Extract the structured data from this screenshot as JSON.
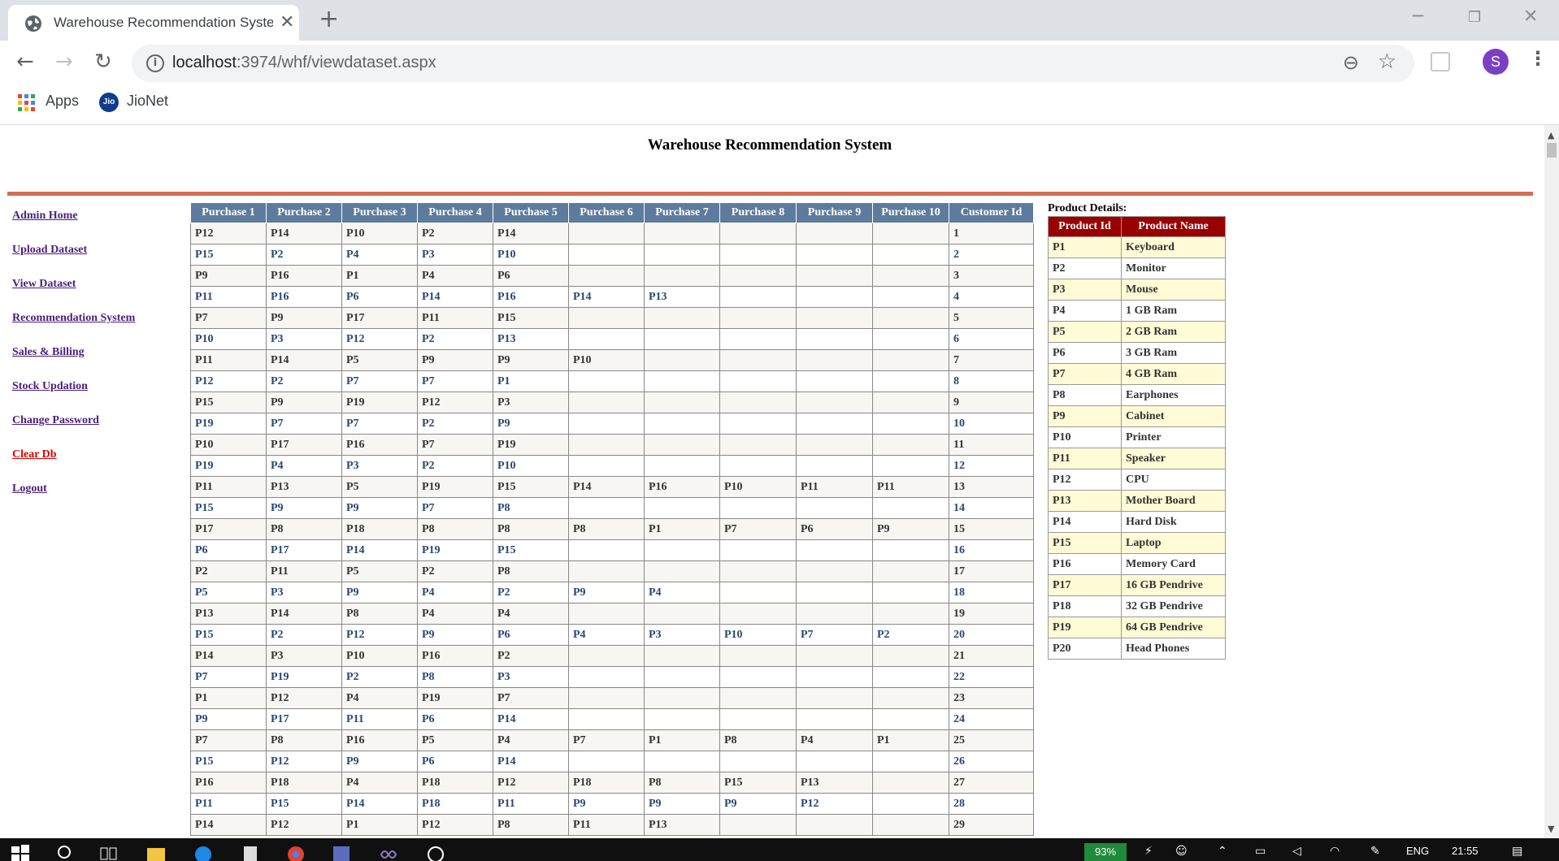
{
  "browser": {
    "tab_title": "Warehouse Recommendation System",
    "url_host": "localhost",
    "url_path": ":3974/whf/viewdataset.aspx",
    "avatar_letter": "S",
    "bookmarks": [
      {
        "label": "Apps",
        "icon": "apps-grid-icon"
      },
      {
        "label": "JioNet",
        "icon": "jio-icon"
      }
    ]
  },
  "page": {
    "title": "Warehouse Recommendation System",
    "rule_color": "#d36f52"
  },
  "menu": [
    {
      "label": "Admin Home"
    },
    {
      "label": "Upload Dataset"
    },
    {
      "label": "View Dataset"
    },
    {
      "label": "Recommendation System"
    },
    {
      "label": "Sales & Billing"
    },
    {
      "label": "Stock Updation"
    },
    {
      "label": "Change Password"
    },
    {
      "label": "Clear Db",
      "danger": true
    },
    {
      "label": "Logout"
    }
  ],
  "dataset": {
    "headers": [
      "Purchase 1",
      "Purchase 2",
      "Purchase 3",
      "Purchase 4",
      "Purchase 5",
      "Purchase 6",
      "Purchase 7",
      "Purchase 8",
      "Purchase 9",
      "Purchase 10",
      "Customer Id"
    ],
    "header_color": "#5d7b9d",
    "rows": [
      [
        "P12",
        "P14",
        "P10",
        "P2",
        "P14",
        "",
        "",
        "",
        "",
        "",
        "1"
      ],
      [
        "P15",
        "P2",
        "P4",
        "P3",
        "P10",
        "",
        "",
        "",
        "",
        "",
        "2"
      ],
      [
        "P9",
        "P16",
        "P1",
        "P4",
        "P6",
        "",
        "",
        "",
        "",
        "",
        "3"
      ],
      [
        "P11",
        "P16",
        "P6",
        "P14",
        "P16",
        "P14",
        "P13",
        "",
        "",
        "",
        "4"
      ],
      [
        "P7",
        "P9",
        "P17",
        "P11",
        "P15",
        "",
        "",
        "",
        "",
        "",
        "5"
      ],
      [
        "P10",
        "P3",
        "P12",
        "P2",
        "P13",
        "",
        "",
        "",
        "",
        "",
        "6"
      ],
      [
        "P11",
        "P14",
        "P5",
        "P9",
        "P9",
        "P10",
        "",
        "",
        "",
        "",
        "7"
      ],
      [
        "P12",
        "P2",
        "P7",
        "P7",
        "P1",
        "",
        "",
        "",
        "",
        "",
        "8"
      ],
      [
        "P15",
        "P9",
        "P19",
        "P12",
        "P3",
        "",
        "",
        "",
        "",
        "",
        "9"
      ],
      [
        "P19",
        "P7",
        "P7",
        "P2",
        "P9",
        "",
        "",
        "",
        "",
        "",
        "10"
      ],
      [
        "P10",
        "P17",
        "P16",
        "P7",
        "P19",
        "",
        "",
        "",
        "",
        "",
        "11"
      ],
      [
        "P19",
        "P4",
        "P3",
        "P2",
        "P10",
        "",
        "",
        "",
        "",
        "",
        "12"
      ],
      [
        "P11",
        "P13",
        "P5",
        "P19",
        "P15",
        "P14",
        "P16",
        "P10",
        "P11",
        "P11",
        "13"
      ],
      [
        "P15",
        "P9",
        "P9",
        "P7",
        "P8",
        "",
        "",
        "",
        "",
        "",
        "14"
      ],
      [
        "P17",
        "P8",
        "P18",
        "P8",
        "P8",
        "P8",
        "P1",
        "P7",
        "P6",
        "P9",
        "15"
      ],
      [
        "P6",
        "P17",
        "P14",
        "P19",
        "P15",
        "",
        "",
        "",
        "",
        "",
        "16"
      ],
      [
        "P2",
        "P11",
        "P5",
        "P2",
        "P8",
        "",
        "",
        "",
        "",
        "",
        "17"
      ],
      [
        "P5",
        "P3",
        "P9",
        "P4",
        "P2",
        "P9",
        "P4",
        "",
        "",
        "",
        "18"
      ],
      [
        "P13",
        "P14",
        "P8",
        "P4",
        "P4",
        "",
        "",
        "",
        "",
        "",
        "19"
      ],
      [
        "P15",
        "P2",
        "P12",
        "P9",
        "P6",
        "P4",
        "P3",
        "P10",
        "P7",
        "P2",
        "20"
      ],
      [
        "P14",
        "P3",
        "P10",
        "P16",
        "P2",
        "",
        "",
        "",
        "",
        "",
        "21"
      ],
      [
        "P7",
        "P19",
        "P2",
        "P8",
        "P3",
        "",
        "",
        "",
        "",
        "",
        "22"
      ],
      [
        "P1",
        "P12",
        "P4",
        "P19",
        "P7",
        "",
        "",
        "",
        "",
        "",
        "23"
      ],
      [
        "P9",
        "P17",
        "P11",
        "P6",
        "P14",
        "",
        "",
        "",
        "",
        "",
        "24"
      ],
      [
        "P7",
        "P8",
        "P16",
        "P5",
        "P4",
        "P7",
        "P1",
        "P8",
        "P4",
        "P1",
        "25"
      ],
      [
        "P15",
        "P12",
        "P9",
        "P6",
        "P14",
        "",
        "",
        "",
        "",
        "",
        "26"
      ],
      [
        "P16",
        "P18",
        "P4",
        "P18",
        "P12",
        "P18",
        "P8",
        "P15",
        "P13",
        "",
        "27"
      ],
      [
        "P11",
        "P15",
        "P14",
        "P18",
        "P11",
        "P9",
        "P9",
        "P9",
        "P12",
        "",
        "28"
      ],
      [
        "P14",
        "P12",
        "P1",
        "P12",
        "P8",
        "P11",
        "P13",
        "",
        "",
        "",
        "29"
      ]
    ]
  },
  "products": {
    "label": "Product Details:",
    "headers": [
      "Product Id",
      "Product Name"
    ],
    "header_color": "#990000",
    "rows": [
      [
        "P1",
        "Keyboard"
      ],
      [
        "P2",
        "Monitor"
      ],
      [
        "P3",
        "Mouse"
      ],
      [
        "P4",
        "1 GB Ram"
      ],
      [
        "P5",
        "2 GB Ram"
      ],
      [
        "P6",
        "3 GB Ram"
      ],
      [
        "P7",
        "4 GB Ram"
      ],
      [
        "P8",
        "Earphones"
      ],
      [
        "P9",
        "Cabinet"
      ],
      [
        "P10",
        "Printer"
      ],
      [
        "P11",
        "Speaker"
      ],
      [
        "P12",
        "CPU"
      ],
      [
        "P13",
        "Mother Board"
      ],
      [
        "P14",
        "Hard Disk"
      ],
      [
        "P15",
        "Laptop"
      ],
      [
        "P16",
        "Memory Card"
      ],
      [
        "P17",
        "16 GB Pendrive"
      ],
      [
        "P18",
        "32 GB Pendrive"
      ],
      [
        "P19",
        "64 GB Pendrive"
      ],
      [
        "P20",
        "Head Phones"
      ]
    ]
  },
  "taskbar": {
    "battery": "93%",
    "language": "ENG",
    "time": "21:55"
  }
}
